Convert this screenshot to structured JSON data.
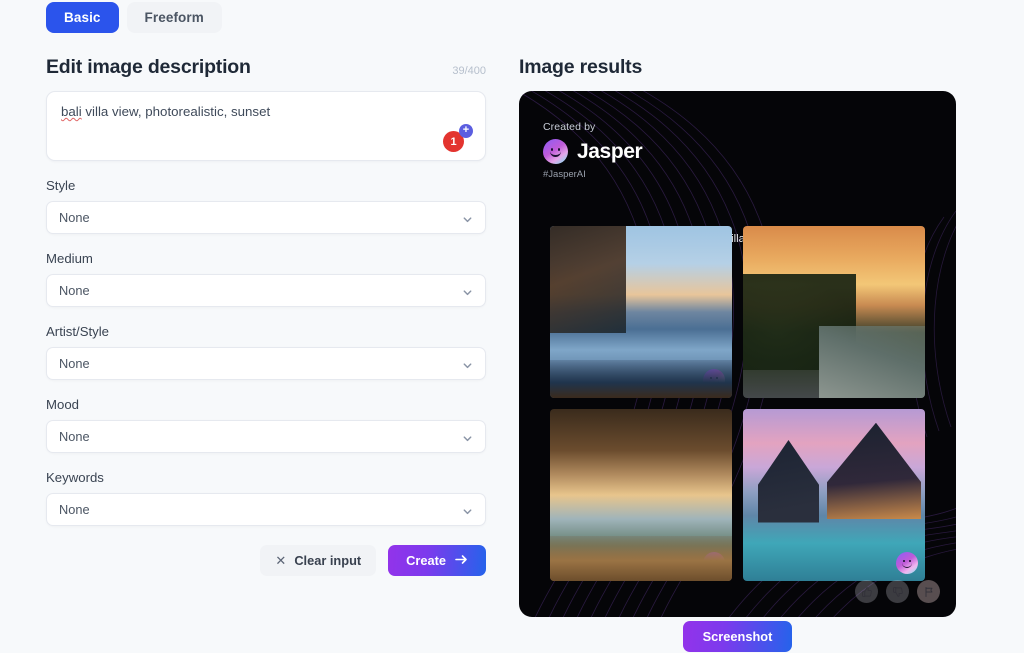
{
  "tabs": [
    {
      "label": "Basic",
      "active": true
    },
    {
      "label": "Freeform",
      "active": false
    }
  ],
  "editor": {
    "title": "Edit image description",
    "counter": "39/400",
    "prompt_text": "bali villa view, photorealistic, sunset",
    "prompt_misspelled_word": "bali",
    "prompt_rest": " villa view, photorealistic, sunset",
    "badge_count": "1",
    "badge_plus": "+",
    "fields": [
      {
        "label": "Style",
        "value": "None"
      },
      {
        "label": "Medium",
        "value": "None"
      },
      {
        "label": "Artist/Style",
        "value": "None"
      },
      {
        "label": "Mood",
        "value": "None"
      },
      {
        "label": "Keywords",
        "value": "None"
      }
    ],
    "clear_label": "Clear input",
    "clear_icon": "close-icon",
    "create_label": "Create",
    "create_icon": "arrow-right-icon"
  },
  "results": {
    "title": "Image results",
    "created_by_label": "Created by",
    "brand_name": "Jasper",
    "hashtag": "#JasperAI",
    "prompt": "bali villa view, photorealistic, sunset",
    "logo_icon": "jasper-smiley-logo",
    "images": [
      {
        "alt": "infinity pool villa with mountain and sea view at dusk",
        "watermark": "jasper-watermark"
      },
      {
        "alt": "tropical palm garden pool at orange sunset",
        "watermark": "jasper-watermark"
      },
      {
        "alt": "wooden pavilion deck facing ocean sunset",
        "watermark": "jasper-watermark"
      },
      {
        "alt": "thatched roof villa with pool under purple sky",
        "watermark": "jasper-watermark"
      }
    ],
    "actions": [
      {
        "name": "thumbs-up-icon",
        "label": "Like"
      },
      {
        "name": "thumbs-down-icon",
        "label": "Dislike"
      },
      {
        "name": "flag-icon",
        "label": "Report"
      }
    ]
  },
  "footer": {
    "screenshot_label": "Screenshot"
  },
  "colors": {
    "page_bg": "#f7f9fb",
    "tab_active": "#2b54ec",
    "create_gradient_start": "#9333ea",
    "create_gradient_end": "#2563eb",
    "badge_red": "#e3342f",
    "badge_blue": "#5b5ee0",
    "card_bg": "#050508"
  }
}
